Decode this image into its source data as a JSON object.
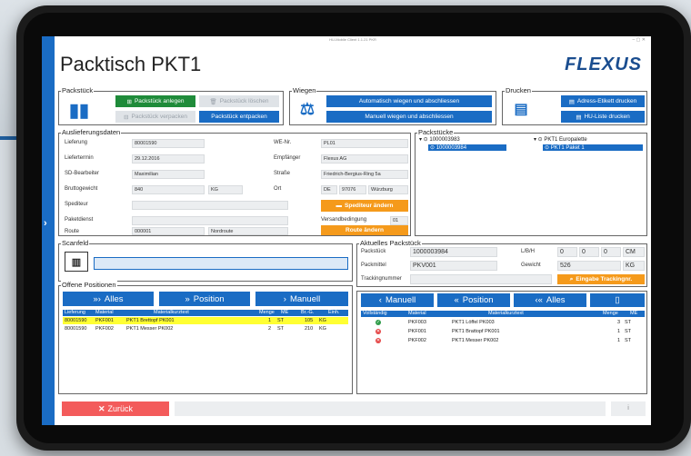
{
  "window": {
    "title": "HU-Mobile Client 1.1.21 PKR",
    "controls": "–  ▢  ✕"
  },
  "app": {
    "title": "Packtisch PKT1",
    "logo": "FLEXUS"
  },
  "packstueck_group": {
    "legend": "Packstück",
    "anlegen": "Packstück anlegen",
    "loeschen": "Packstück löschen",
    "verpacken": "Packstück verpacken",
    "entpacken": "Packstück entpacken"
  },
  "wiegen_group": {
    "legend": "Wiegen",
    "auto": "Automatisch wiegen und abschliessen",
    "manuell": "Manuell wiegen und abschliessen"
  },
  "drucken_group": {
    "legend": "Drucken",
    "adress": "Adress-Etikett drucken",
    "hu": "HU-Liste drucken"
  },
  "auslieferung": {
    "legend": "Auslieferungsdaten",
    "lieferung_lbl": "Lieferung",
    "lieferung": "80001590",
    "liefertermin_lbl": "Liefertermin",
    "liefertermin": "29.12.2016",
    "sd_lbl": "SD-Bearbeiter",
    "sd": "Maximilian",
    "brutto_lbl": "Bruttogewicht",
    "brutto": "840",
    "brutto_unit": "KG",
    "spediteur_lbl": "Spediteur",
    "spediteur": "",
    "paketdienst_lbl": "Paketdienst",
    "paketdienst": "",
    "route_lbl": "Route",
    "route": "000001",
    "route_name": "Nordroute",
    "we_lbl": "WE-Nr.",
    "we": "PL01",
    "empf_lbl": "Empfänger",
    "empf": "Flexus AG",
    "strasse_lbl": "Straße",
    "strasse": "Friedrich-Bergius-Ring 5a",
    "ort_lbl": "Ort",
    "land": "DE",
    "plz": "97076",
    "ort": "Würzburg",
    "spediteur_btn": "Spediteur ändern",
    "versand_lbl": "Versandbedingung",
    "versand": "01",
    "route_btn": "Route ändern"
  },
  "packstuecke": {
    "legend": "Packstücke",
    "root1": "1000003983",
    "child1": "1000003984",
    "root2": "PKT1 Europalette",
    "child2": "PKT1 Paket 1"
  },
  "scanfeld": {
    "legend": "Scanfeld",
    "value": ""
  },
  "aktuelles": {
    "legend": "Aktuelles Packstück",
    "ps_lbl": "Packstück",
    "ps": "1000003984",
    "lbh_lbl": "L/B/H",
    "l": "0",
    "b": "0",
    "h": "0",
    "lbh_unit": "CM",
    "pm_lbl": "Packmittel",
    "pm": "PKV001",
    "gew_lbl": "Gewicht",
    "gew": "526",
    "gew_unit": "KG",
    "track_lbl": "Trackingnummer",
    "track": "",
    "track_btn": "Eingabe Trackingnr."
  },
  "offene": {
    "legend": "Offene Positionen",
    "btn_alles": "Alles",
    "btn_position": "Position",
    "btn_manuell": "Manuell",
    "headers": [
      "Lieferung",
      "Material",
      "Materialkurztext",
      "Menge",
      "ME",
      "Br.-G.",
      "Einh."
    ],
    "rows": [
      [
        "80001590",
        "PKF001",
        "PKT1 Brettopf PK001",
        "1",
        "ST",
        "105",
        "KG"
      ],
      [
        "80001590",
        "PKF002",
        "PKT1 Messer PK002",
        "2",
        "ST",
        "210",
        "KG"
      ]
    ]
  },
  "inhalt": {
    "btn_manuell": "Manuell",
    "btn_position": "Position",
    "btn_alles": "Alles",
    "headers": [
      "Vollständig",
      "Material",
      "Materialkurztext",
      "Menge",
      "ME"
    ],
    "rows": [
      {
        "status": "ok",
        "material": "PKF003",
        "text": "PKT1 Löffel PK003",
        "menge": "3",
        "me": "ST"
      },
      {
        "status": "err",
        "material": "PKF001",
        "text": "PKT1 Brattopf PK001",
        "menge": "1",
        "me": "ST"
      },
      {
        "status": "err",
        "material": "PKF002",
        "text": "PKT1 Messer PK002",
        "menge": "1",
        "me": "ST"
      }
    ]
  },
  "footer": {
    "back": "Zurück",
    "info": "i"
  },
  "colors": {
    "primary": "#1a6cc4",
    "green": "#1f8b3a",
    "orange": "#f59a1b",
    "red": "#f35b5b",
    "highlight": "#ffff33"
  }
}
